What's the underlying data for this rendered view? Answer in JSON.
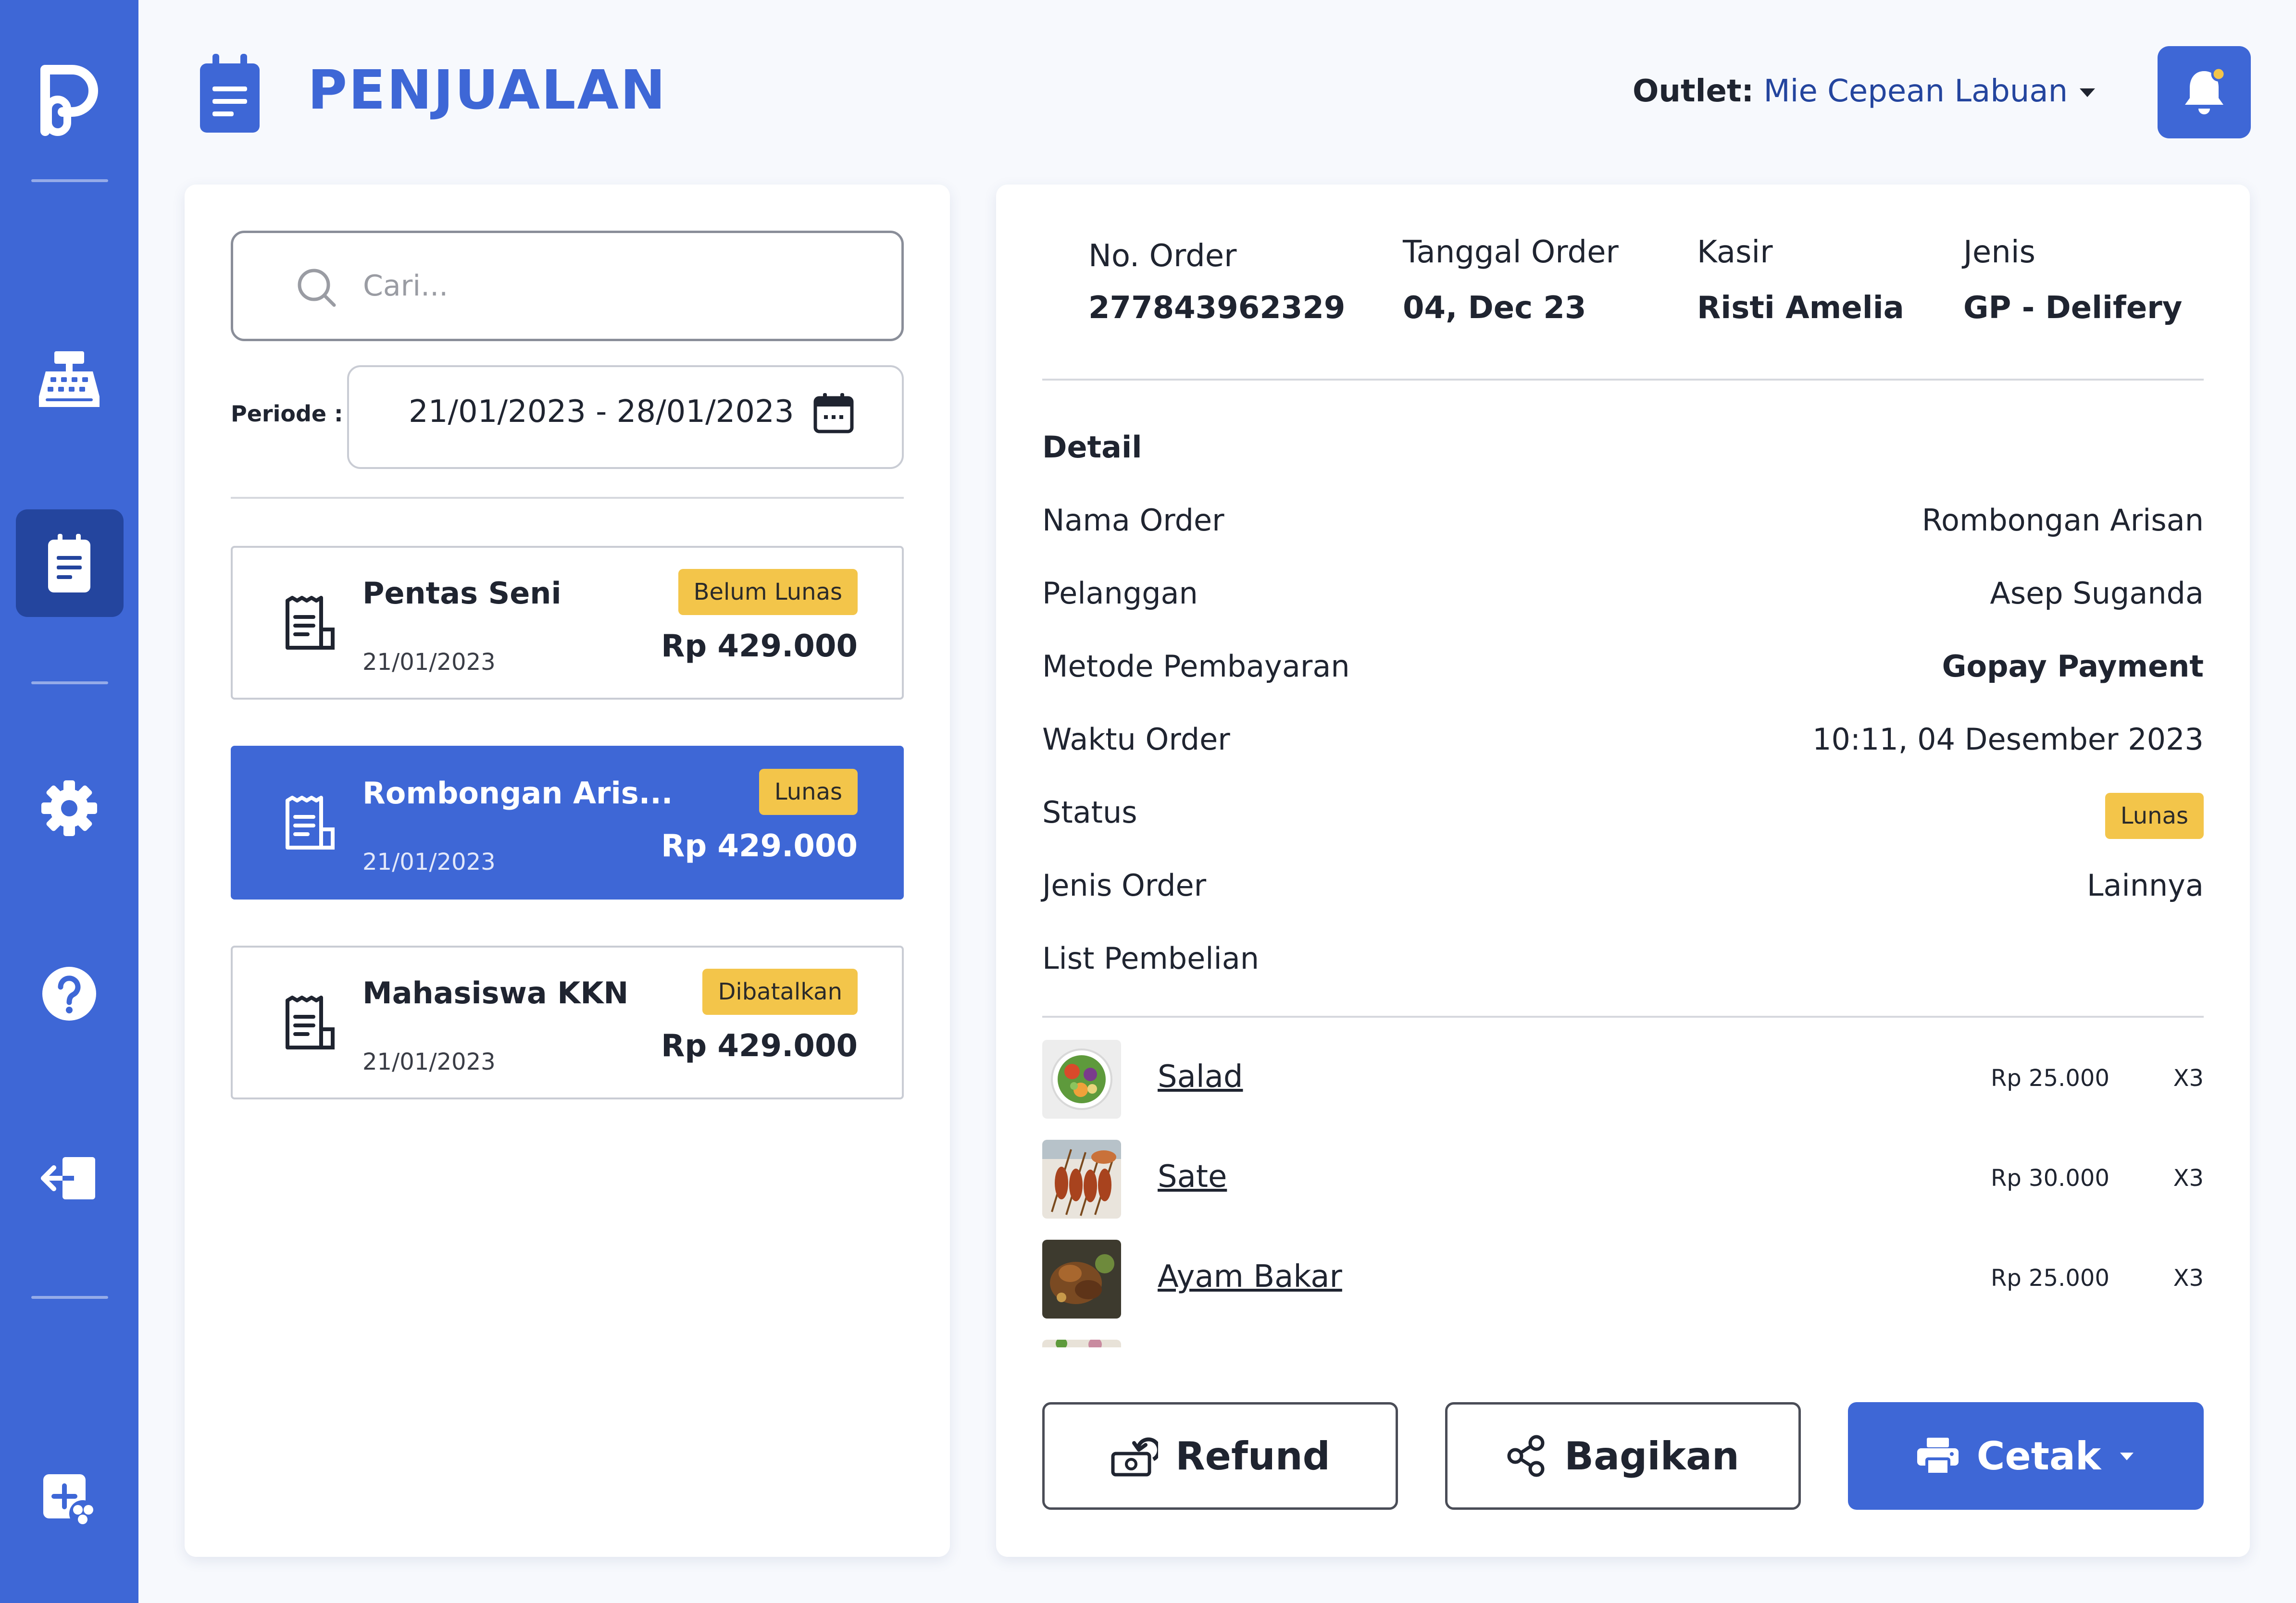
{
  "colors": {
    "brand": "#3E67D6",
    "brand_dark": "#24459E",
    "badge": "#F3C54A",
    "background": "#F7F9FD"
  },
  "sidebar": {
    "items": [
      {
        "icon": "logo-icon"
      },
      {
        "icon": "cash-register-icon"
      },
      {
        "icon": "sales-note-icon",
        "active": true
      },
      {
        "icon": "gear-icon"
      },
      {
        "icon": "help-icon"
      },
      {
        "icon": "logout-icon"
      },
      {
        "icon": "add-outlet-icon"
      }
    ]
  },
  "header": {
    "title": "PENJUALAN",
    "outlet_label": "Outlet:",
    "outlet_value": "Mie Cepean Labuan",
    "icons": [
      "chevron-down-icon",
      "bell-icon"
    ]
  },
  "search": {
    "placeholder": "Cari...",
    "value": ""
  },
  "periode": {
    "label": "Periode :",
    "range": "21/01/2023 - 28/01/2023"
  },
  "orders": [
    {
      "name": "Pentas Seni",
      "date": "21/01/2023",
      "price": "Rp 429.000",
      "status": "Belum Lunas",
      "active": false
    },
    {
      "name": "Rombongan Aris...",
      "date": "21/01/2023",
      "price": "Rp 429.000",
      "status": "Lunas",
      "active": true
    },
    {
      "name": "Mahasiswa KKN",
      "date": "21/01/2023",
      "price": "Rp 429.000",
      "status": "Dibatalkan",
      "active": false
    }
  ],
  "order_info": {
    "no_label": "No. Order",
    "no_value": "277843962329",
    "date_label": "Tanggal Order",
    "date_value": "04, Dec 23",
    "cashier_label": "Kasir",
    "cashier_value": "Risti Amelia",
    "type_label": "Jenis",
    "type_value": "GP - Delifery"
  },
  "detail": {
    "heading": "Detail",
    "rows": [
      {
        "label": "Nama Order",
        "value": "Rombongan Arisan"
      },
      {
        "label": "Pelanggan",
        "value": "Asep Suganda"
      },
      {
        "label": "Metode Pembayaran",
        "value": "Gopay Payment"
      },
      {
        "label": "Waktu Order",
        "value": "10:11, 04 Desember 2023"
      },
      {
        "label": "Status",
        "value": "Lunas"
      },
      {
        "label": "Jenis Order",
        "value": "Lainnya"
      }
    ],
    "list_heading": "List Pembelian"
  },
  "items": [
    {
      "name": "Salad",
      "price": "Rp 25.000",
      "qty": "X3"
    },
    {
      "name": "Sate",
      "price": "Rp 30.000",
      "qty": "X3"
    },
    {
      "name": "Ayam Bakar",
      "price": "Rp 25.000",
      "qty": "X3"
    }
  ],
  "actions": {
    "refund": "Refund",
    "share": "Bagikan",
    "print": "Cetak"
  }
}
